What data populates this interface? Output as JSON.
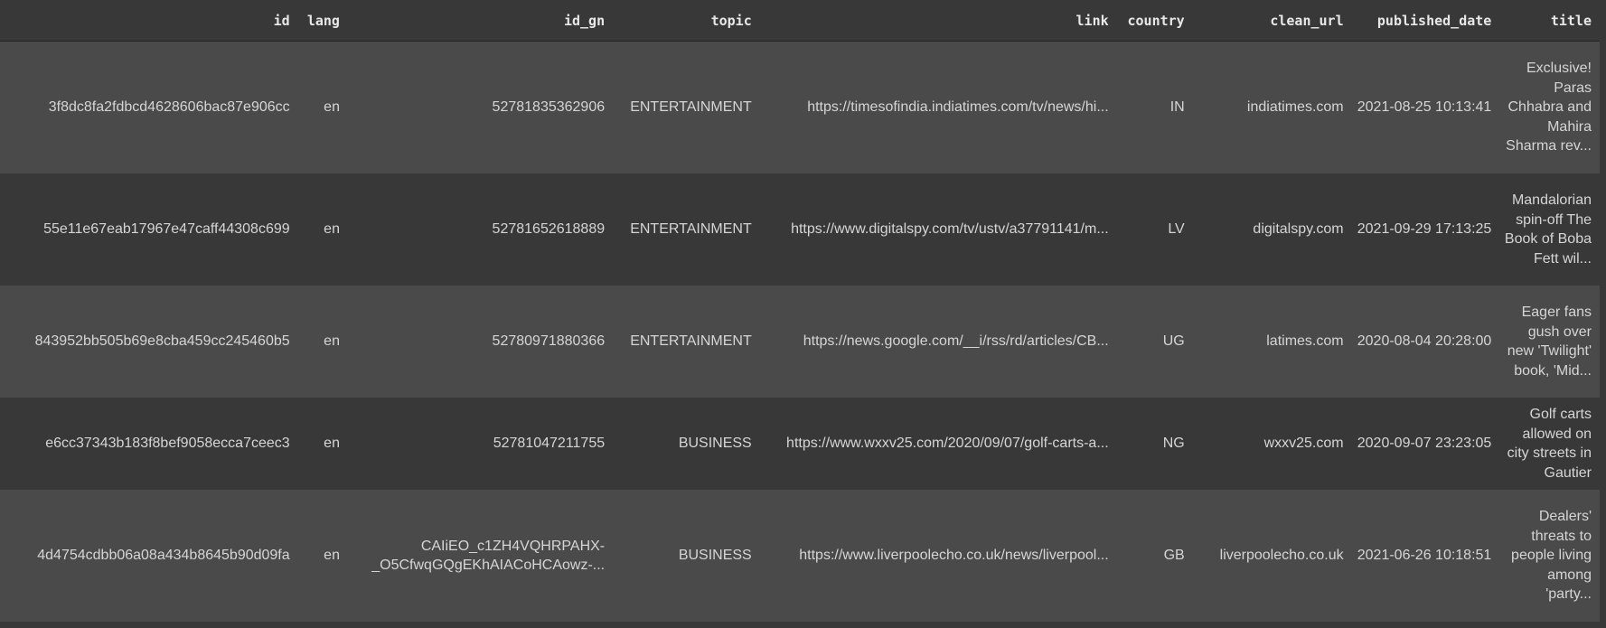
{
  "columns": [
    "id",
    "lang",
    "id_gn",
    "topic",
    "link",
    "country",
    "clean_url",
    "published_date",
    "title"
  ],
  "rows": [
    {
      "id": "3f8dc8fa2fdbcd4628606bac87e906cc",
      "lang": "en",
      "id_gn": "52781835362906",
      "topic": "ENTERTAINMENT",
      "link": "https://timesofindia.indiatimes.com/tv/news/hi...",
      "country": "IN",
      "clean_url": "indiatimes.com",
      "published_date": "2021-08-25 10:13:41",
      "title": "Exclusive! Paras Chhabra and Mahira Sharma rev..."
    },
    {
      "id": "55e11e67eab17967e47caff44308c699",
      "lang": "en",
      "id_gn": "52781652618889",
      "topic": "ENTERTAINMENT",
      "link": "https://www.digitalspy.com/tv/ustv/a37791141/m...",
      "country": "LV",
      "clean_url": "digitalspy.com",
      "published_date": "2021-09-29 17:13:25",
      "title": "Mandalorian spin-off The Book of Boba Fett wil..."
    },
    {
      "id": "843952bb505b69e8cba459cc245460b5",
      "lang": "en",
      "id_gn": "52780971880366",
      "topic": "ENTERTAINMENT",
      "link": "https://news.google.com/__i/rss/rd/articles/CB...",
      "country": "UG",
      "clean_url": "latimes.com",
      "published_date": "2020-08-04 20:28:00",
      "title": "Eager fans gush over new 'Twilight' book, 'Mid..."
    },
    {
      "id": "e6cc37343b183f8bef9058ecca7ceec3",
      "lang": "en",
      "id_gn": "52781047211755",
      "topic": "BUSINESS",
      "link": "https://www.wxxv25.com/2020/09/07/golf-carts-a...",
      "country": "NG",
      "clean_url": "wxxv25.com",
      "published_date": "2020-09-07 23:23:05",
      "title": "Golf carts allowed on city streets in Gautier"
    },
    {
      "id": "4d4754cdbb06a08a434b8645b90d09fa",
      "lang": "en",
      "id_gn": "CAIiEO_c1ZH4VQHRPAHX-_O5CfwqGQgEKhAIACoHCAowz-...",
      "topic": "BUSINESS",
      "link": "https://www.liverpoolecho.co.uk/news/liverpool...",
      "country": "GB",
      "clean_url": "liverpoolecho.co.uk",
      "published_date": "2021-06-26 10:18:51",
      "title": "Dealers' threats to people living among 'party..."
    }
  ]
}
